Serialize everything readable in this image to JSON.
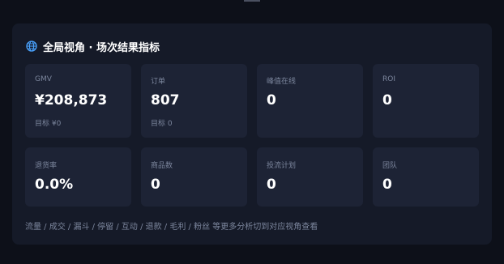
{
  "panel": {
    "title": "全局视角 · 场次结果指标",
    "icon": "globe-icon",
    "accent_color": "#4aa3ff"
  },
  "metrics": [
    {
      "label": "GMV",
      "value": "¥208,873",
      "sub": "目标 ¥0"
    },
    {
      "label": "订单",
      "value": "807",
      "sub": "目标 0"
    },
    {
      "label": "峰值在线",
      "value": "0",
      "sub": ""
    },
    {
      "label": "ROI",
      "value": "0",
      "sub": ""
    },
    {
      "label": "退货率",
      "value": "0.0%",
      "sub": ""
    },
    {
      "label": "商品数",
      "value": "0",
      "sub": ""
    },
    {
      "label": "投流计划",
      "value": "0",
      "sub": ""
    },
    {
      "label": "团队",
      "value": "0",
      "sub": ""
    }
  ],
  "footer": {
    "note": "流量 / 成交 / 漏斗 / 停留 / 互动 / 退款 / 毛利 / 粉丝 等更多分析切到对应视角查看"
  }
}
